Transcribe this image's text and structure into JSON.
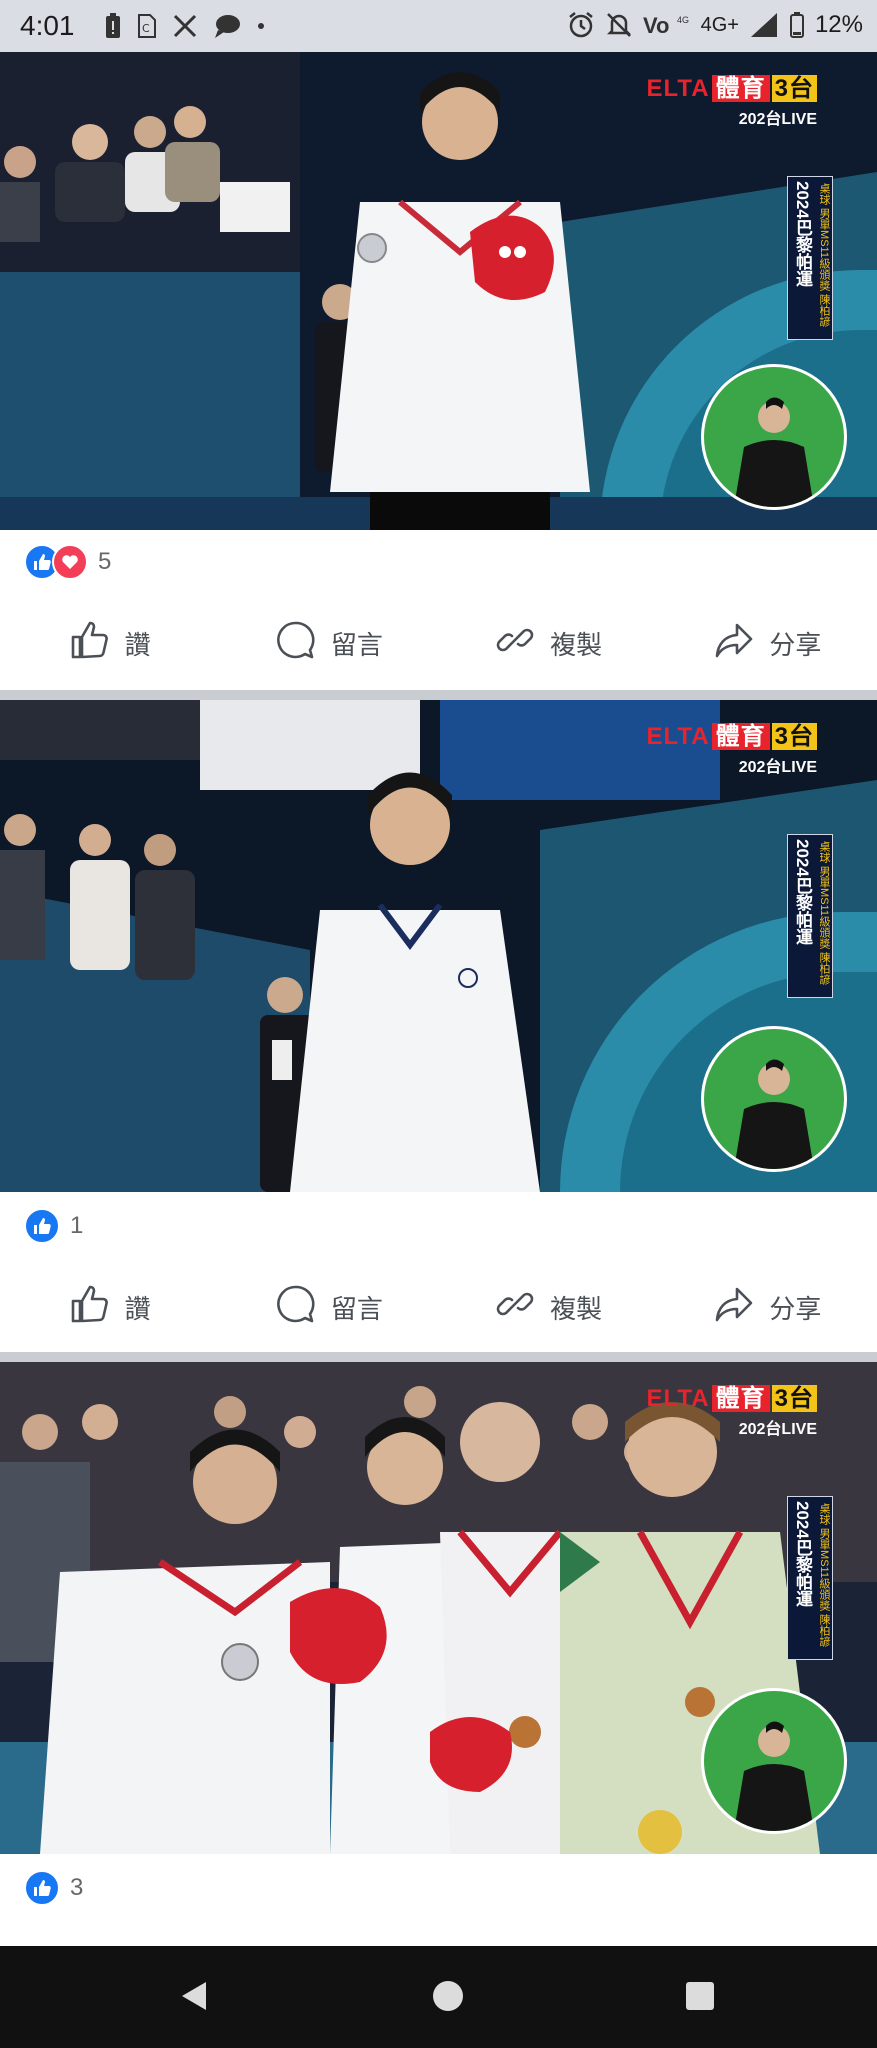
{
  "status_bar": {
    "time": "4:01",
    "network": "4G+",
    "battery": "12%",
    "left_icons": [
      "battery-alert-icon",
      "sim-icon",
      "x-app-icon",
      "chat-bubble-icon",
      "dot-icon"
    ],
    "right_icons": [
      "alarm-icon",
      "mute-icon",
      "volte-icon",
      "signal-icon",
      "battery-icon"
    ]
  },
  "broadcast": {
    "brand": "ELTA",
    "brand_ch": "體育",
    "channel": "3台",
    "sub": "202台LIVE",
    "badge_main": "2024巴黎帕運",
    "badge_sub": "桌球 男單MS11級頒獎 陳柏諺"
  },
  "posts": [
    {
      "reaction_count": "5",
      "reactions": [
        "like",
        "love"
      ]
    },
    {
      "reaction_count": "1",
      "reactions": [
        "like"
      ]
    },
    {
      "reaction_count": "3",
      "reactions": [
        "like"
      ]
    }
  ],
  "actions": {
    "like": "讚",
    "comment": "留言",
    "copy": "複製",
    "share": "分享"
  },
  "colors": {
    "facebook_blue": "#1877f2",
    "love_red": "#f33e58",
    "divider": "#c9ccd1",
    "action_text": "#4b4f56"
  }
}
